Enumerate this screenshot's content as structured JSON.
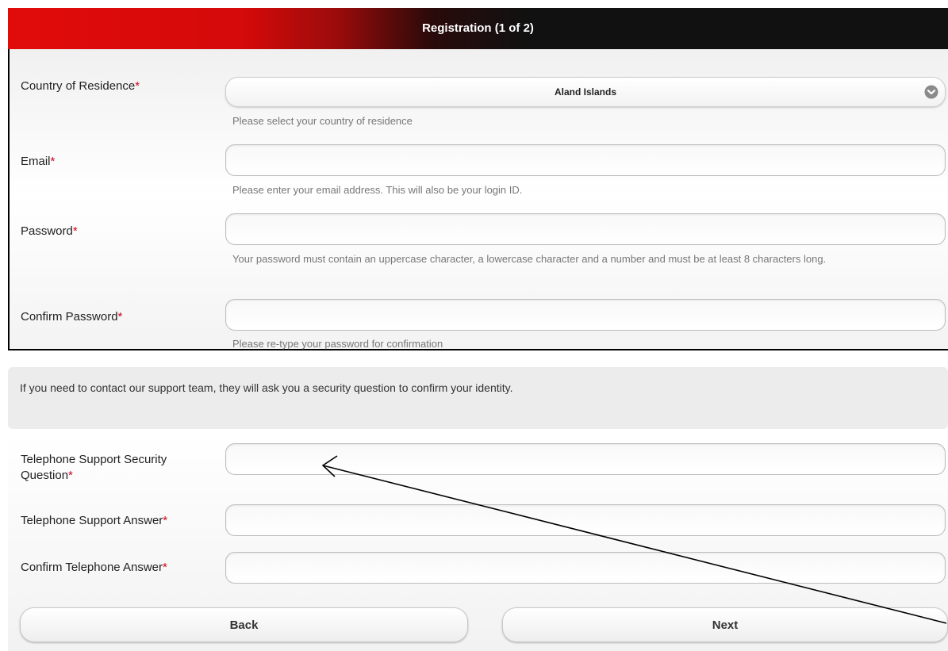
{
  "header": {
    "title": "Registration (1 of 2)"
  },
  "required_marker": "*",
  "country": {
    "label": "Country of Residence",
    "selected": "Aland Islands",
    "hint": "Please select your country of residence"
  },
  "email": {
    "label": "Email",
    "value": "",
    "hint": "Please enter your email address. This will also be your login ID."
  },
  "password": {
    "label": "Password",
    "value": "",
    "hint": "Your password must contain an uppercase character, a lowercase character and a number and must be at least 8 characters long."
  },
  "confirm_password": {
    "label": "Confirm Password",
    "value": "",
    "hint": "Please re-type your password for confirmation"
  },
  "info": {
    "text": "If you need to contact our support team, they will ask you a security question to confirm your identity."
  },
  "security_question": {
    "label": "Telephone Support Security Question",
    "value": ""
  },
  "security_answer": {
    "label": "Telephone Support Answer",
    "value": ""
  },
  "confirm_answer": {
    "label": "Confirm Telephone Answer",
    "value": ""
  },
  "buttons": {
    "back": "Back",
    "next": "Next"
  },
  "icons": {
    "dropdown": "chevron-down-circle-icon"
  },
  "colors": {
    "accent_red": "#e10b0b",
    "required": "#d0021b",
    "header_dark": "#111111"
  }
}
